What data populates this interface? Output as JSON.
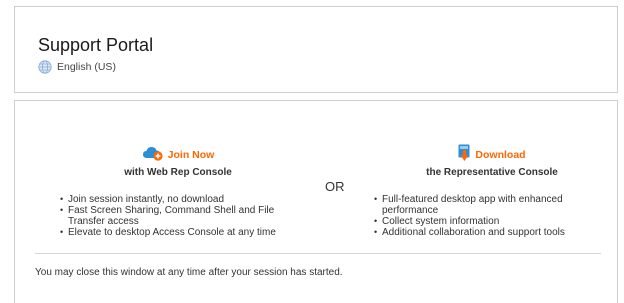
{
  "header": {
    "title": "Support Portal",
    "language": "English (US)",
    "language_icon": "globe-icon"
  },
  "options": {
    "left": {
      "cta_label": "Join Now",
      "cta_icon": "cloud-plus-icon",
      "subtitle": "with Web Rep Console",
      "features": [
        "Join session instantly, no download",
        "Fast Screen Sharing, Command Shell and File Transfer access",
        "Elevate to desktop Access Console at any time"
      ]
    },
    "separator": "OR",
    "right": {
      "cta_label": "Download",
      "cta_icon": "download-icon",
      "subtitle": "the Representative Console",
      "features": [
        "Full-featured desktop app with enhanced performance",
        "Collect system information",
        "Additional collaboration and support tools"
      ]
    }
  },
  "footer": {
    "note": "You may close this window at any time after your session has started."
  },
  "colors": {
    "accent": "#ff6600",
    "icon_blue": "#2a8fd6",
    "border": "#cfcfcf"
  }
}
